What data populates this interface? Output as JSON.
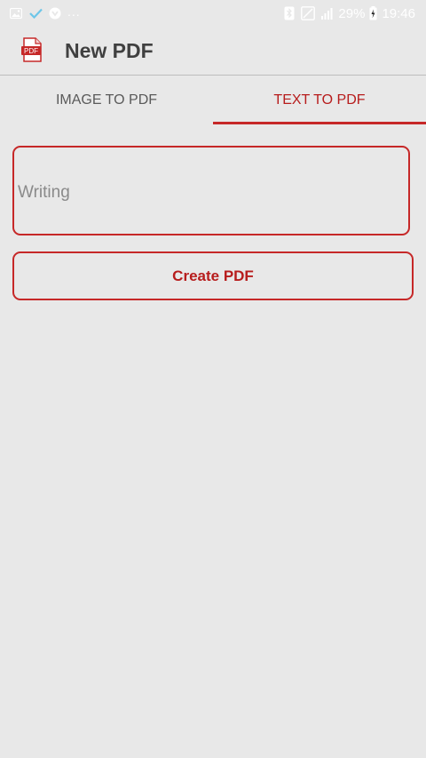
{
  "status_bar": {
    "left_icons": [
      "gallery-icon",
      "check-icon",
      "shield-icon"
    ],
    "overflow_indicator": "...",
    "right_icons": [
      "bluetooth-icon",
      "no-sim-icon",
      "signal-icon"
    ],
    "battery_percent": "29%",
    "time": "19:46"
  },
  "app_bar": {
    "logo_text": "PDF",
    "title": "New PDF"
  },
  "tabs": [
    {
      "label": "IMAGE TO PDF",
      "active": false
    },
    {
      "label": "TEXT TO PDF",
      "active": true
    }
  ],
  "editor": {
    "placeholder": "Writing"
  },
  "actions": {
    "create_label": "Create PDF"
  },
  "colors": {
    "accent": "#c62828",
    "background": "#e8e8e8"
  }
}
